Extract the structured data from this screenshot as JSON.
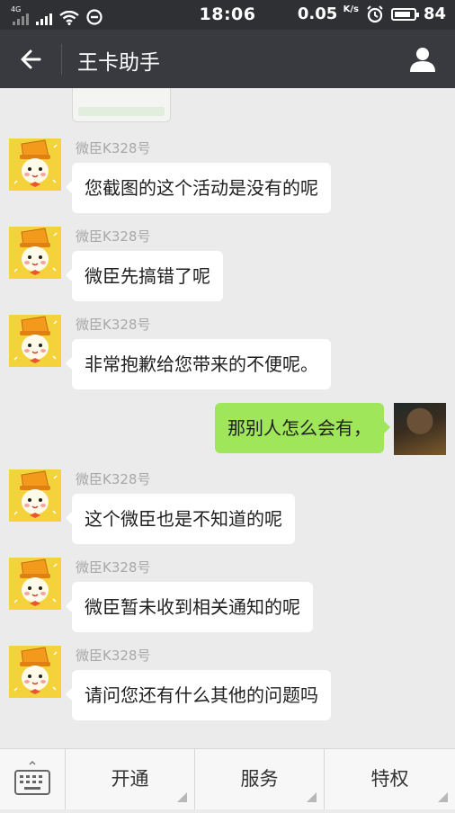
{
  "status_bar": {
    "network": "4G",
    "time": "18:06",
    "speed": "0.05",
    "speed_unit": "K/s",
    "battery": "84",
    "battery_level": 0.84
  },
  "header": {
    "title": "王卡助手",
    "back_icon": "arrow-left-icon",
    "profile_icon": "person-icon"
  },
  "messages": [
    {
      "sender": "微臣K328号",
      "text": "您截图的这个活动是没有的呢"
    },
    {
      "sender": "微臣K328号",
      "text": "微臣先搞错了呢"
    },
    {
      "sender": "微臣K328号",
      "text": "非常抱歉给您带来的不便呢。"
    },
    {
      "sender": "me",
      "text": "那别人怎么会有，"
    },
    {
      "sender": "微臣K328号",
      "text": "这个微臣也是不知道的呢"
    },
    {
      "sender": "微臣K328号",
      "text": "微臣暂未收到相关通知的呢"
    },
    {
      "sender": "微臣K328号",
      "text": "请问您还有什么其他的问题吗"
    }
  ],
  "bottom_menu": {
    "keyboard_icon": "keyboard-icon",
    "items": [
      {
        "label": "开通"
      },
      {
        "label": "服务"
      },
      {
        "label": "特权"
      }
    ]
  },
  "colors": {
    "header_bg": "#393a3f",
    "my_bubble": "#9fe65a",
    "their_bubble": "#ffffff",
    "chat_bg": "#ebebeb"
  }
}
